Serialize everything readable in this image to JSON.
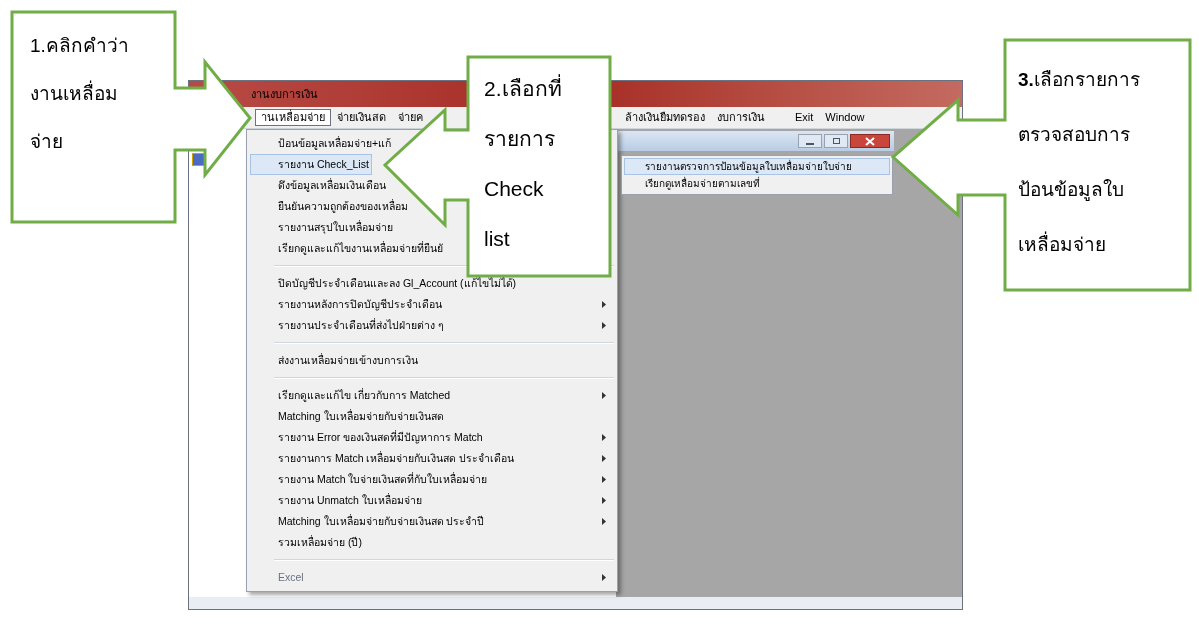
{
  "window": {
    "title": "งานงบการเงิน"
  },
  "menu_bar": [
    {
      "label": "านเหลื่อมจ่าย",
      "selected": true
    },
    {
      "label": "จ่ายเงินสด",
      "selected": false
    },
    {
      "label": "จ่ายค",
      "selected": false
    },
    {
      "label": "ล้างเงินยืมทดรอง",
      "selected": false
    },
    {
      "label": "งบการเงิน",
      "selected": false
    },
    {
      "label": "Exit",
      "selected": false
    },
    {
      "label": "Window",
      "selected": false
    }
  ],
  "dropdown_menu": [
    {
      "kind": "item",
      "label": "ป้อนข้อมูลเหลื่อมจ่าย+แก้",
      "selected": false,
      "submenu": false,
      "disabled": false
    },
    {
      "kind": "item",
      "label": "รายงาน Check_List",
      "selected": true,
      "submenu": false,
      "disabled": false
    },
    {
      "kind": "item",
      "label": "ดึงข้อมูลเหลื่อมเงินเดือน",
      "selected": false,
      "submenu": false,
      "disabled": false
    },
    {
      "kind": "item",
      "label": "ยืนยันความถูกต้องของเหลื่อม",
      "selected": false,
      "submenu": false,
      "disabled": false
    },
    {
      "kind": "item",
      "label": "รายงานสรุปใบเหลื่อมจ่าย",
      "selected": false,
      "submenu": false,
      "disabled": false
    },
    {
      "kind": "item",
      "label": "เรียกดูและแก้ไขงานเหลื่อมจ่ายที่ยืนยั",
      "selected": false,
      "submenu": false,
      "disabled": false
    },
    {
      "kind": "separator"
    },
    {
      "kind": "item",
      "label": "ปิดบัญชีประจำเดือนและลง Gl_Account (แก้ไขไม่ได้)",
      "selected": false,
      "submenu": false,
      "disabled": false
    },
    {
      "kind": "item",
      "label": "รายงานหลังการปิดบัญชีประจำเดือน",
      "selected": false,
      "submenu": true,
      "disabled": false
    },
    {
      "kind": "item",
      "label": "รายงานประจำเดือนที่ส่งไปฝ่ายต่าง ๆ",
      "selected": false,
      "submenu": true,
      "disabled": false
    },
    {
      "kind": "separator"
    },
    {
      "kind": "item",
      "label": "ส่งงานเหลื่อมจ่ายเข้างบการเงิน",
      "selected": false,
      "submenu": false,
      "disabled": false
    },
    {
      "kind": "separator"
    },
    {
      "kind": "item",
      "label": "เรียกดูและแก้ไข เกี่ยวกับการ Matched",
      "selected": false,
      "submenu": true,
      "disabled": false
    },
    {
      "kind": "item",
      "label": "Matching ใบเหลื่อมจ่ายกับจ่ายเงินสด",
      "selected": false,
      "submenu": false,
      "disabled": false
    },
    {
      "kind": "item",
      "label": "รายงาน Error ของเงินสดที่มีปัญหาการ Match",
      "selected": false,
      "submenu": true,
      "disabled": false
    },
    {
      "kind": "item",
      "label": "รายงานการ Match เหลื่อมจ่ายกับเงินสด ประจำเดือน",
      "selected": false,
      "submenu": true,
      "disabled": false
    },
    {
      "kind": "item",
      "label": "รายงาน Match ใบจ่ายเงินสดที่กับใบเหลื่อมจ่าย",
      "selected": false,
      "submenu": true,
      "disabled": false
    },
    {
      "kind": "item",
      "label": "รายงาน Unmatch ใบเหลื่อมจ่าย",
      "selected": false,
      "submenu": true,
      "disabled": false
    },
    {
      "kind": "item",
      "label": "Matching ใบเหลื่อมจ่ายกับจ่ายเงินสด ประจำปี",
      "selected": false,
      "submenu": true,
      "disabled": false
    },
    {
      "kind": "item",
      "label": "รวมเหลื่อมจ่าย (ปี)",
      "selected": false,
      "submenu": false,
      "disabled": false
    },
    {
      "kind": "separator"
    },
    {
      "kind": "item",
      "label": "Excel",
      "selected": false,
      "submenu": true,
      "disabled": true
    }
  ],
  "submenu": [
    {
      "label": "รายงานตรวจการป้อนข้อมูลใบเหลื่อมจ่ายใบจ่าย",
      "selected": true
    },
    {
      "label": "เรียกดูเหลื่อมจ่ายตามเลขที่",
      "selected": false
    }
  ],
  "callouts": [
    {
      "text": "1.คลิกคำว่า\nงานเหลื่อม\nจ่าย"
    },
    {
      "text": "2.เลือกที่\nรายการ\nCheck\nlist"
    },
    {
      "text": "**3.**เลือกรายการ\nตรวจสอบการ\nป้อนข้อมูลใบ\nเหลื่อมจ่าย"
    }
  ]
}
